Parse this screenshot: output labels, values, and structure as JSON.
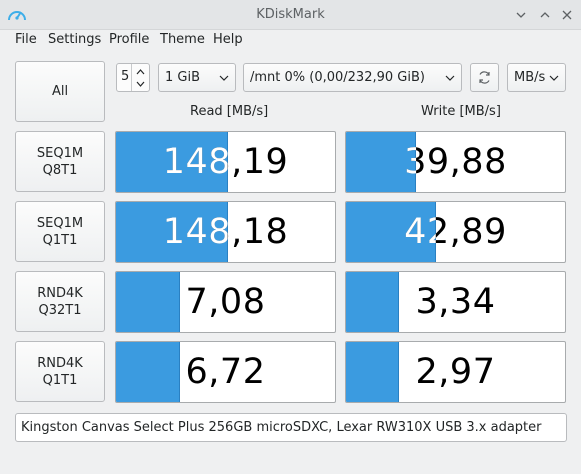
{
  "window": {
    "title": "KDiskMark"
  },
  "menu": [
    "File",
    "Settings",
    "Profile",
    "Theme",
    "Help"
  ],
  "controls": {
    "all_label": "All",
    "runs": "5",
    "size": "1 GiB",
    "target": "/mnt 0% (0,00/232,90 GiB)",
    "unit": "MB/s"
  },
  "headers": {
    "read": "Read [MB/s]",
    "write": "Write [MB/s]"
  },
  "tests": [
    {
      "line1": "SEQ1M",
      "line2": "Q8T1",
      "read": "148,19",
      "write": "39,88",
      "read_fill": 0.51,
      "write_fill": 0.32
    },
    {
      "line1": "SEQ1M",
      "line2": "Q1T1",
      "read": "148,18",
      "write": "42,89",
      "read_fill": 0.51,
      "write_fill": 0.41
    },
    {
      "line1": "RND4K",
      "line2": "Q32T1",
      "read": "7,08",
      "write": "3,34",
      "read_fill": 0.29,
      "write_fill": 0.24
    },
    {
      "line1": "RND4K",
      "line2": "Q1T1",
      "read": "6,72",
      "write": "2,97",
      "read_fill": 0.29,
      "write_fill": 0.24
    }
  ],
  "comment": "Kingston Canvas Select Plus 256GB microSDXC, Lexar RW310X USB 3.x adapter",
  "colors": {
    "bar_fill": "#3b9be0",
    "accent": "#3daee9"
  },
  "icons": {
    "app": "speedometer-icon",
    "refresh": "refresh-icon"
  }
}
